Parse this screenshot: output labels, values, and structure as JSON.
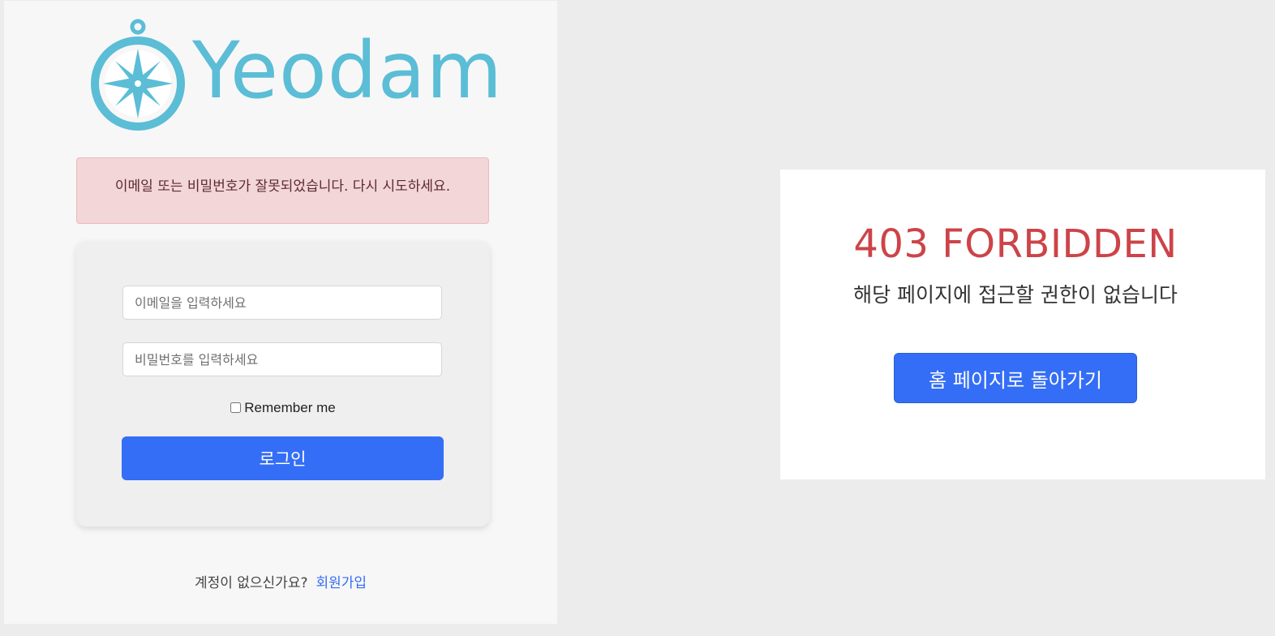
{
  "login": {
    "logo": {
      "text": "Yeodam",
      "icon": "compass-icon",
      "color": "#5bbdd6"
    },
    "alert": {
      "message": "이메일 또는 비밀번호가 잘못되었습니다. 다시 시도하세요."
    },
    "form": {
      "email_placeholder": "이메일을 입력하세요",
      "email_value": "",
      "password_placeholder": "비밀번호를 입력하세요",
      "password_value": "",
      "remember_label": "Remember me",
      "remember_checked": false,
      "submit_label": "로그인"
    },
    "signup": {
      "prompt": "계정이 없으신가요?",
      "link_label": "회원가입"
    }
  },
  "forbidden": {
    "title": "403 FORBIDDEN",
    "message": "해당 페이지에 접근할 권한이 없습니다",
    "home_button_label": "홈 페이지로 돌아가기"
  },
  "colors": {
    "primary": "#346ef6",
    "error_text": "#cc4449",
    "alert_bg": "#f3d6d8",
    "logo": "#5bbdd6"
  }
}
